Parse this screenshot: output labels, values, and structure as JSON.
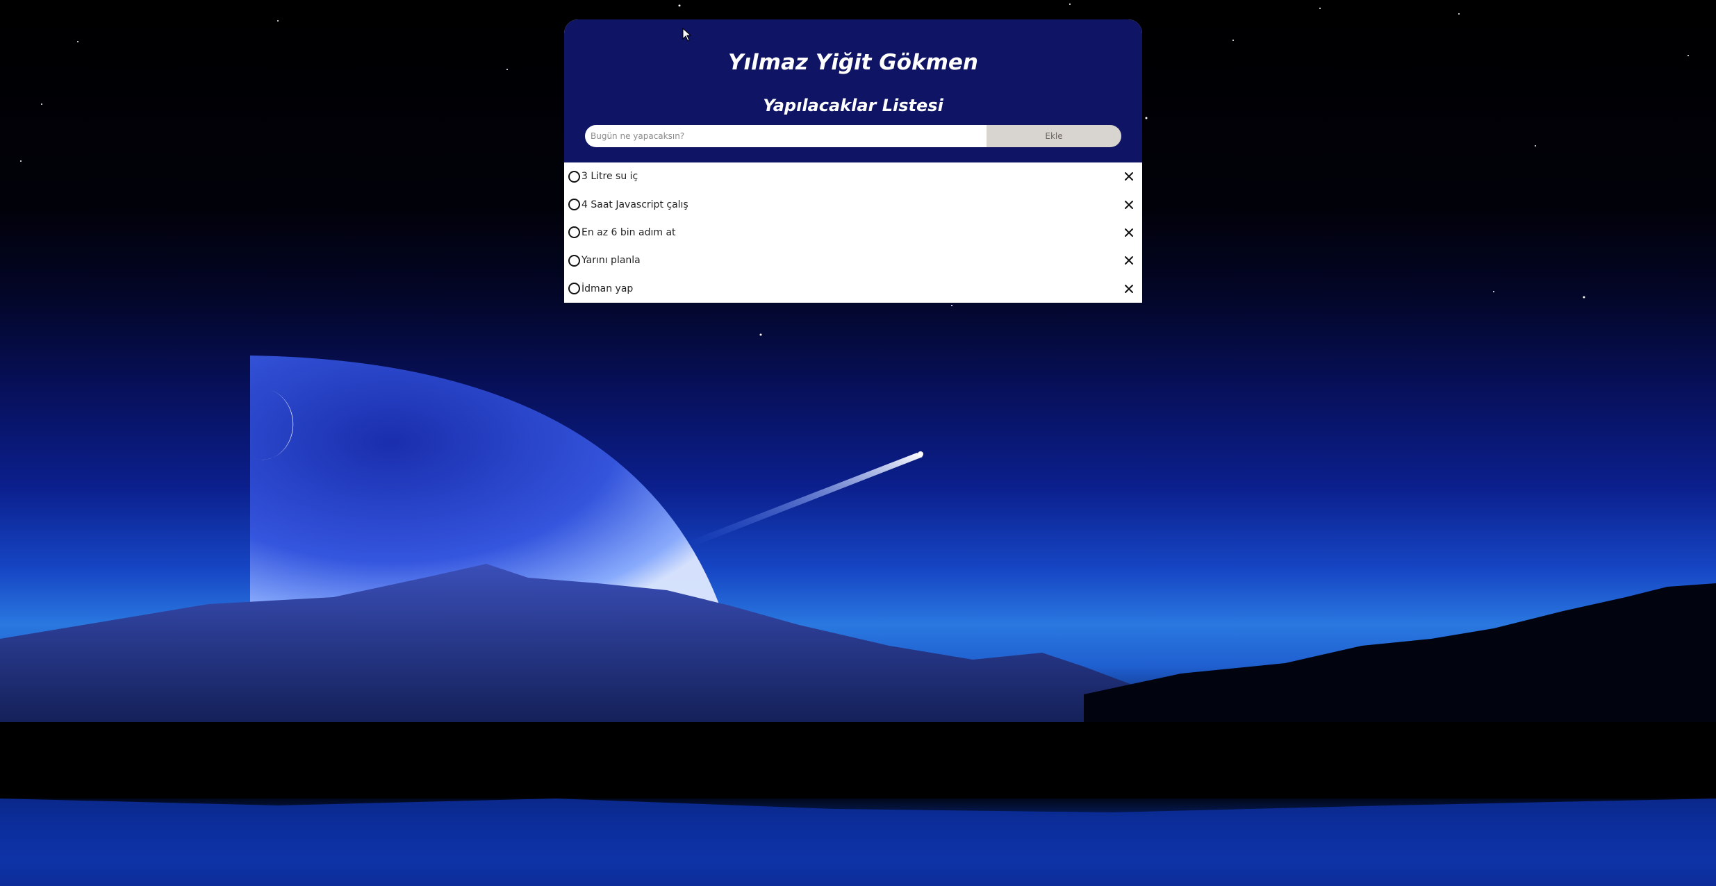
{
  "header": {
    "app_title": "Yılmaz Yiğit Gökmen",
    "list_title": "Yapılacaklar Listesi"
  },
  "add_form": {
    "input_placeholder": "Bugün ne yapacaksın?",
    "input_value": "",
    "add_button_label": "Ekle"
  },
  "todos": [
    {
      "text": "3 Litre su iç",
      "done": false
    },
    {
      "text": "4 Saat Javascript çalış",
      "done": false
    },
    {
      "text": "En az 6 bin adım at",
      "done": false
    },
    {
      "text": "Yarını planla",
      "done": false
    },
    {
      "text": "İdman yap",
      "done": false
    }
  ],
  "icons": {
    "check": "empty-circle-icon",
    "delete": "close-icon",
    "cursor": "mouse-cursor-icon"
  },
  "colors": {
    "header_bg": "#0f1464",
    "button_bg": "#d8d4cf",
    "text": "#222222"
  }
}
